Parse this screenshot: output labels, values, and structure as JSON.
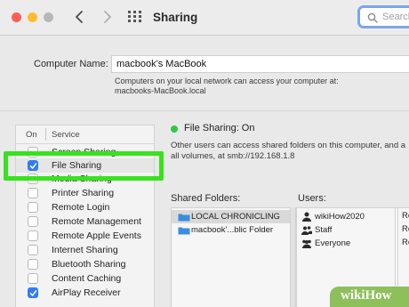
{
  "window": {
    "title": "Sharing",
    "search_placeholder": "Search"
  },
  "computer_name": {
    "label": "Computer Name:",
    "value": "macbook's MacBook",
    "note_line1": "Computers on your local network can access your computer at:",
    "note_line2": "macbooks-MacBook.local"
  },
  "services": {
    "header_on": "On",
    "header_service": "Service",
    "items": [
      {
        "label": "Screen Sharing",
        "checked": false
      },
      {
        "label": "File Sharing",
        "checked": true
      },
      {
        "label": "Media Sharing",
        "checked": false
      },
      {
        "label": "Printer Sharing",
        "checked": false
      },
      {
        "label": "Remote Login",
        "checked": false
      },
      {
        "label": "Remote Management",
        "checked": false
      },
      {
        "label": "Remote Apple Events",
        "checked": false
      },
      {
        "label": "Internet Sharing",
        "checked": false
      },
      {
        "label": "Bluetooth Sharing",
        "checked": false
      },
      {
        "label": "Content Caching",
        "checked": false
      },
      {
        "label": "AirPlay Receiver",
        "checked": true
      }
    ]
  },
  "status": {
    "text": "File Sharing: On",
    "info_line1": "Other users can access shared folders on this computer, and a",
    "info_line2": "all volumes, at smb://192.168.1.8",
    "color": "#2ec845"
  },
  "shared_folders": {
    "label": "Shared Folders:",
    "items": [
      "LOCAL CHRONICLING",
      "macbook'...blic Folder"
    ]
  },
  "users": {
    "label": "Users:",
    "items": [
      "wikiHow2020",
      "Staff",
      "Everyone"
    ],
    "rights": [
      "Re",
      "Re",
      "Re"
    ]
  },
  "watermark": "wikiHow",
  "colors": {
    "accent": "#2f7cf6",
    "highlight": "#38e21d",
    "folder": "#3b8de0"
  }
}
